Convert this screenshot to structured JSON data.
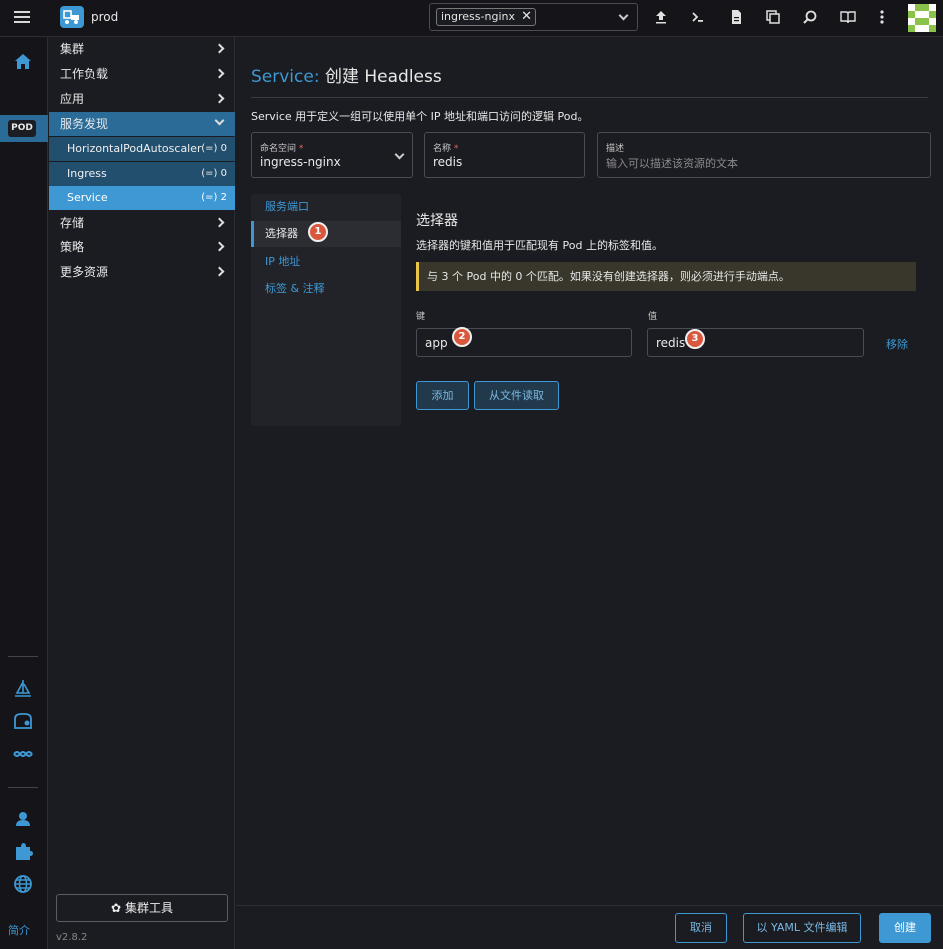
{
  "header": {
    "cluster_name": "prod",
    "namespace_chip": "ingress-nginx"
  },
  "rail": {
    "pod_badge": "POD",
    "about": "简介"
  },
  "nav": {
    "items": [
      {
        "label": "集群"
      },
      {
        "label": "工作负载"
      },
      {
        "label": "应用"
      },
      {
        "label": "服务发现"
      },
      {
        "label": "存储"
      },
      {
        "label": "策略"
      },
      {
        "label": "更多资源"
      }
    ],
    "sub_items": [
      {
        "label": "HorizontalPodAutoscaler",
        "count": "(=) 0"
      },
      {
        "label": "Ingress",
        "count": "(=) 0"
      },
      {
        "label": "Service",
        "count": "(=) 2"
      }
    ],
    "tools_button": "集群工具",
    "version": "v2.8.2"
  },
  "main": {
    "title_kind": "Service:",
    "title_action": "创建 Headless",
    "description": "Service 用于定义一组可以使用单个 IP 地址和端口访问的逻辑 Pod。",
    "namespace_field": {
      "label": "命名空间",
      "required": "*",
      "value": "ingress-nginx"
    },
    "name_field": {
      "label": "名称",
      "required": "*",
      "value": "redis"
    },
    "description_field": {
      "label": "描述",
      "placeholder": "输入可以描述该资源的文本"
    },
    "tabs": [
      {
        "label": "服务端口"
      },
      {
        "label": "选择器"
      },
      {
        "label": "IP 地址"
      },
      {
        "label": "标签 & 注释"
      }
    ],
    "selector": {
      "title": "选择器",
      "description": "选择器的键和值用于匹配现有 Pod 上的标签和值。",
      "banner": "与 3 个 Pod 中的 0 个匹配。如果没有创建选择器，则必须进行手动端点。",
      "key_label": "键",
      "value_label": "值",
      "key_value": "app",
      "value_value": "redis",
      "remove": "移除",
      "add": "添加",
      "read_file": "从文件读取"
    },
    "badges": [
      "1",
      "2",
      "3"
    ]
  },
  "footer": {
    "cancel": "取消",
    "edit_yaml": "以 YAML 文件编辑",
    "create": "创建"
  },
  "colors": {
    "accent": "#3d98d3",
    "warning": "#e8c547",
    "badge": "#d9573c"
  }
}
